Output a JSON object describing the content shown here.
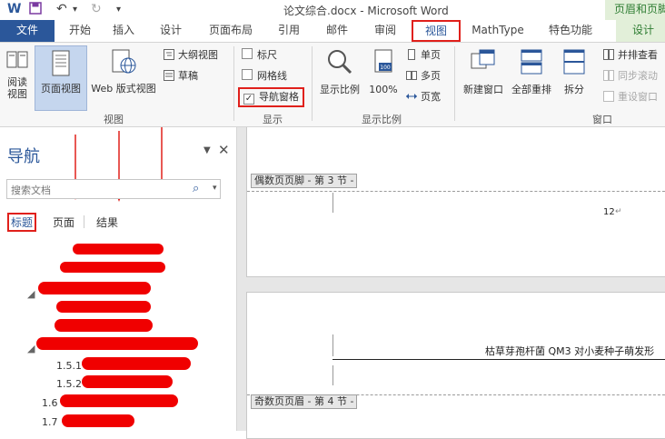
{
  "window": {
    "title": "论文综合.docx - Microsoft Word"
  },
  "context_tab_header": "页眉和页脚",
  "tabs": [
    {
      "label": "文件"
    },
    {
      "label": "开始"
    },
    {
      "label": "插入"
    },
    {
      "label": "设计"
    },
    {
      "label": "页面布局"
    },
    {
      "label": "引用"
    },
    {
      "label": "邮件"
    },
    {
      "label": "审阅"
    },
    {
      "label": "视图"
    },
    {
      "label": "MathType"
    },
    {
      "label": "特色功能"
    },
    {
      "label": "设计"
    }
  ],
  "ribbon": {
    "views": {
      "read_mode": "阅读\n视图",
      "print_layout": "页面视图",
      "web_layout": "Web 版式视图",
      "outline": "大纲视图",
      "draft": "草稿",
      "group_label": "视图"
    },
    "show": {
      "ruler": "标尺",
      "gridlines": "网格线",
      "nav_pane": "导航窗格",
      "nav_pane_checked": true,
      "group_label": "显示"
    },
    "zoom": {
      "zoom": "显示比例",
      "hundred": "100%",
      "one_page": "单页",
      "multi_page": "多页",
      "page_width": "页宽",
      "group_label": "显示比例"
    },
    "window": {
      "new_window": "新建窗口",
      "arrange_all": "全部重排",
      "split": "拆分",
      "side_by_side": "并排查看",
      "sync_scroll": "同步滚动",
      "reset_pos": "重设窗口",
      "group_label": "窗口"
    }
  },
  "nav": {
    "title": "导航",
    "search_placeholder": "搜索文档",
    "tabs": {
      "headings": "标题",
      "pages": "页面",
      "results": "结果"
    },
    "outline": [
      "1.5.1",
      "1.5.2",
      "1.6",
      "1.7"
    ]
  },
  "doc": {
    "even_footer": "偶数页页脚 - 第 3 节 -",
    "page_number": "12",
    "header_text": "枯草芽孢杆菌 QM3 对小麦种子萌发形",
    "odd_header": "奇数页页眉 - 第 4 节 -"
  },
  "colors": {
    "accent": "#2b579a",
    "highlight": "#e0201b",
    "context": "#e2efd9"
  }
}
